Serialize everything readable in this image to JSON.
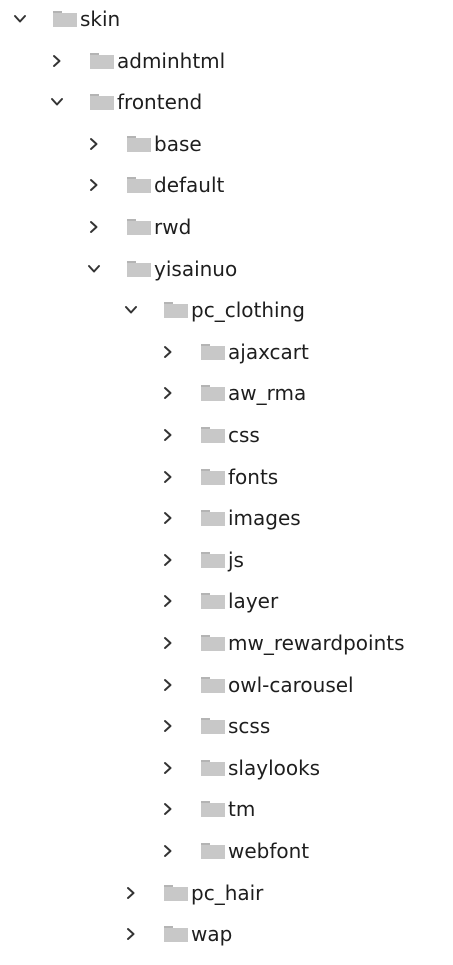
{
  "tree": {
    "nodes": [
      {
        "label": "skin",
        "depth": 0,
        "expanded": true
      },
      {
        "label": "adminhtml",
        "depth": 1,
        "expanded": false
      },
      {
        "label": "frontend",
        "depth": 1,
        "expanded": true
      },
      {
        "label": "base",
        "depth": 2,
        "expanded": false
      },
      {
        "label": "default",
        "depth": 2,
        "expanded": false
      },
      {
        "label": "rwd",
        "depth": 2,
        "expanded": false
      },
      {
        "label": "yisainuo",
        "depth": 2,
        "expanded": true
      },
      {
        "label": "pc_clothing",
        "depth": 3,
        "expanded": true
      },
      {
        "label": "ajaxcart",
        "depth": 4,
        "expanded": false
      },
      {
        "label": "aw_rma",
        "depth": 4,
        "expanded": false
      },
      {
        "label": "css",
        "depth": 4,
        "expanded": false
      },
      {
        "label": "fonts",
        "depth": 4,
        "expanded": false
      },
      {
        "label": "images",
        "depth": 4,
        "expanded": false
      },
      {
        "label": "js",
        "depth": 4,
        "expanded": false
      },
      {
        "label": "layer",
        "depth": 4,
        "expanded": false
      },
      {
        "label": "mw_rewardpoints",
        "depth": 4,
        "expanded": false
      },
      {
        "label": "owl-carousel",
        "depth": 4,
        "expanded": false
      },
      {
        "label": "scss",
        "depth": 4,
        "expanded": false
      },
      {
        "label": "slaylooks",
        "depth": 4,
        "expanded": false
      },
      {
        "label": "tm",
        "depth": 4,
        "expanded": false
      },
      {
        "label": "webfont",
        "depth": 4,
        "expanded": false
      },
      {
        "label": "pc_hair",
        "depth": 3,
        "expanded": false
      },
      {
        "label": "wap",
        "depth": 3,
        "expanded": false
      }
    ]
  },
  "colors": {
    "folder": "#c8c8c8",
    "folder_tab": "#b4b4b4",
    "chevron": "#333333",
    "text": "#1e1e1e"
  },
  "icons": {
    "expanded": "chevron-down-icon",
    "collapsed": "chevron-right-icon",
    "folder": "folder-icon"
  }
}
